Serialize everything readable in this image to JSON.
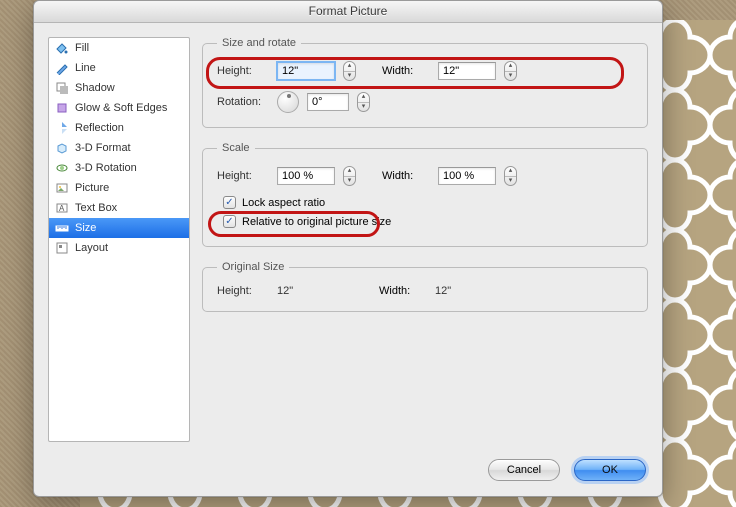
{
  "dialog": {
    "title": "Format Picture"
  },
  "sidebar": {
    "items": [
      {
        "label": "Fill"
      },
      {
        "label": "Line"
      },
      {
        "label": "Shadow"
      },
      {
        "label": "Glow & Soft Edges"
      },
      {
        "label": "Reflection"
      },
      {
        "label": "3-D Format"
      },
      {
        "label": "3-D Rotation"
      },
      {
        "label": "Picture"
      },
      {
        "label": "Text Box"
      },
      {
        "label": "Size"
      },
      {
        "label": "Layout"
      }
    ],
    "selected_index": 9
  },
  "size_rotate": {
    "legend": "Size and rotate",
    "height_label": "Height:",
    "height_value": "12\"",
    "width_label": "Width:",
    "width_value": "12\"",
    "rotation_label": "Rotation:",
    "rotation_value": "0°"
  },
  "scale": {
    "legend": "Scale",
    "height_label": "Height:",
    "height_value": "100 %",
    "width_label": "Width:",
    "width_value": "100 %",
    "lock_label": "Lock aspect ratio",
    "lock_checked": true,
    "relative_label": "Relative to original picture size",
    "relative_checked": true
  },
  "original": {
    "legend": "Original Size",
    "height_label": "Height:",
    "height_value": "12\"",
    "width_label": "Width:",
    "width_value": "12\""
  },
  "footer": {
    "cancel": "Cancel",
    "ok": "OK"
  }
}
